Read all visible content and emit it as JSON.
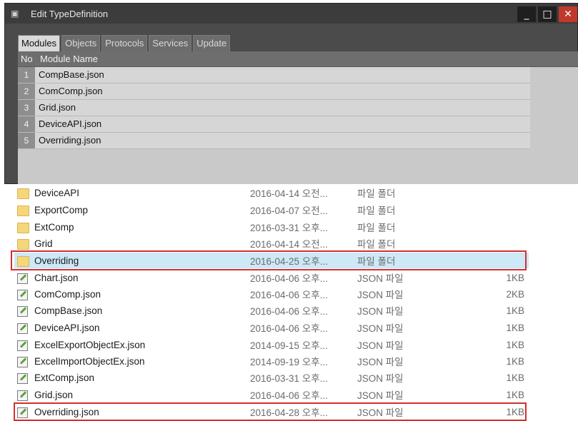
{
  "dialog": {
    "title": "Edit TypeDefinition",
    "icon": "window-icon",
    "buttons": {
      "minimize": "_",
      "maximize": "□",
      "close": "✕"
    },
    "tabs": [
      {
        "label": "Modules",
        "active": true
      },
      {
        "label": "Objects",
        "active": false
      },
      {
        "label": "Protocols",
        "active": false
      },
      {
        "label": "Services",
        "active": false
      },
      {
        "label": "Update",
        "active": false
      }
    ],
    "table": {
      "headers": {
        "no": "No",
        "name": "Module Name"
      },
      "rows": [
        {
          "no": "1",
          "name": "CompBase.json"
        },
        {
          "no": "2",
          "name": "ComComp.json"
        },
        {
          "no": "3",
          "name": "Grid.json"
        },
        {
          "no": "4",
          "name": "DeviceAPI.json"
        },
        {
          "no": "5",
          "name": "Overriding.json"
        }
      ]
    }
  },
  "explorer": {
    "rows": [
      {
        "icon": "folder-icon",
        "name": "DeviceAPI",
        "date": "2016-04-14 오전...",
        "type": "파일 폴더",
        "size": ""
      },
      {
        "icon": "folder-icon",
        "name": "ExportComp",
        "date": "2016-04-07 오전...",
        "type": "파일 폴더",
        "size": ""
      },
      {
        "icon": "folder-icon",
        "name": "ExtComp",
        "date": "2016-03-31 오후...",
        "type": "파일 폴더",
        "size": ""
      },
      {
        "icon": "folder-icon",
        "name": "Grid",
        "date": "2016-04-14 오전...",
        "type": "파일 폴더",
        "size": ""
      },
      {
        "icon": "folder-icon",
        "name": "Overriding",
        "date": "2016-04-25 오후...",
        "type": "파일 폴더",
        "size": "",
        "selected": true,
        "highlighted": true
      },
      {
        "icon": "json-file-icon",
        "name": "Chart.json",
        "date": "2016-04-06 오후...",
        "type": "JSON 파일",
        "size": "1KB"
      },
      {
        "icon": "json-file-icon",
        "name": "ComComp.json",
        "date": "2016-04-06 오후...",
        "type": "JSON 파일",
        "size": "2KB"
      },
      {
        "icon": "json-file-icon",
        "name": "CompBase.json",
        "date": "2016-04-06 오후...",
        "type": "JSON 파일",
        "size": "1KB"
      },
      {
        "icon": "json-file-icon",
        "name": "DeviceAPI.json",
        "date": "2016-04-06 오후...",
        "type": "JSON 파일",
        "size": "1KB"
      },
      {
        "icon": "json-file-icon",
        "name": "ExcelExportObjectEx.json",
        "date": "2014-09-15 오후...",
        "type": "JSON 파일",
        "size": "1KB"
      },
      {
        "icon": "json-file-icon",
        "name": "ExcelImportObjectEx.json",
        "date": "2014-09-19 오후...",
        "type": "JSON 파일",
        "size": "1KB"
      },
      {
        "icon": "json-file-icon",
        "name": "ExtComp.json",
        "date": "2016-03-31 오후...",
        "type": "JSON 파일",
        "size": "1KB"
      },
      {
        "icon": "json-file-icon",
        "name": "Grid.json",
        "date": "2016-04-06 오후...",
        "type": "JSON 파일",
        "size": "1KB"
      },
      {
        "icon": "json-file-icon",
        "name": "Overriding.json",
        "date": "2016-04-28 오후...",
        "type": "JSON 파일",
        "size": "1KB",
        "highlighted": true
      }
    ]
  },
  "colors": {
    "highlight_border": "#d32f2f",
    "selected_row": "#cde8f7",
    "close_button": "#c0392b"
  }
}
